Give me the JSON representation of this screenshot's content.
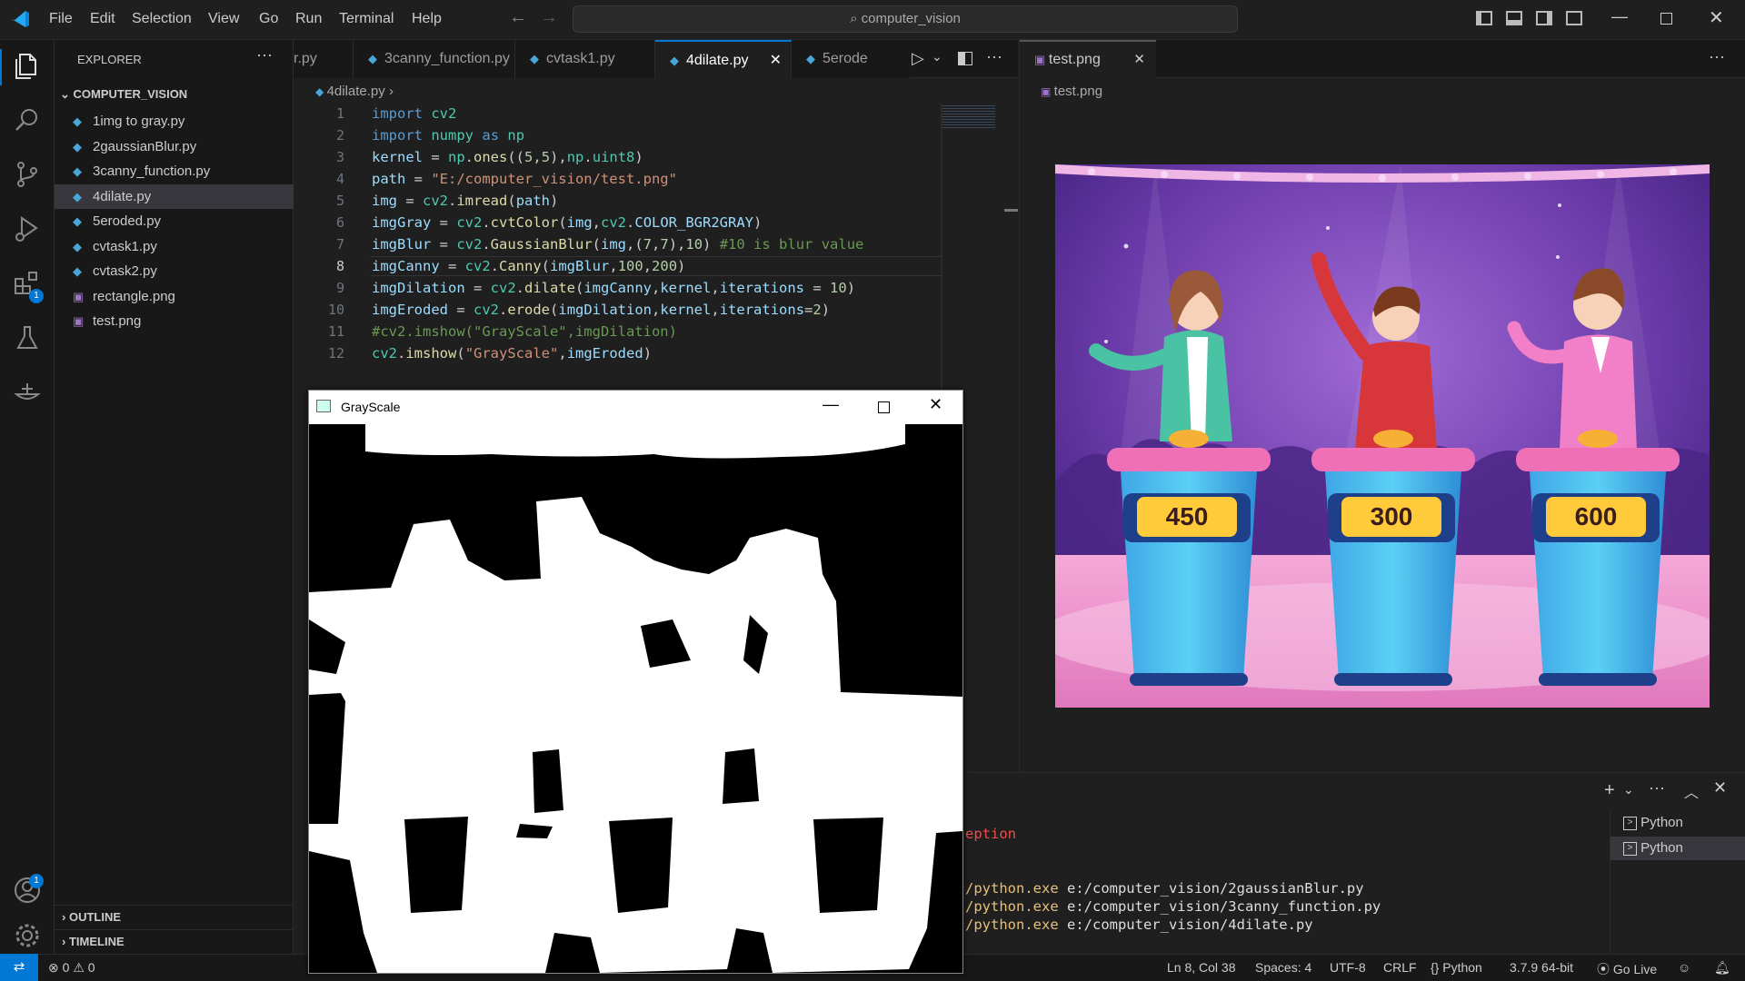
{
  "menu": [
    "File",
    "Edit",
    "Selection",
    "View",
    "Go",
    "Run",
    "Terminal",
    "Help"
  ],
  "search_text": "computer_vision",
  "activity_badges": {
    "extensions": "1",
    "accounts": "1"
  },
  "explorer": {
    "title": "EXPLORER",
    "folder": "COMPUTER_VISION",
    "files": [
      {
        "name": "1img to gray.py",
        "type": "py"
      },
      {
        "name": "2gaussianBlur.py",
        "type": "py"
      },
      {
        "name": "3canny_function.py",
        "type": "py"
      },
      {
        "name": "4dilate.py",
        "type": "py",
        "selected": true
      },
      {
        "name": "5eroded.py",
        "type": "py"
      },
      {
        "name": "cvtask1.py",
        "type": "py"
      },
      {
        "name": "cvtask2.py",
        "type": "py"
      },
      {
        "name": "rectangle.png",
        "type": "png"
      },
      {
        "name": "test.png",
        "type": "png"
      }
    ],
    "outline": "OUTLINE",
    "timeline": "TIMELINE"
  },
  "tabs": [
    {
      "label": "r.py"
    },
    {
      "label": "3canny_function.py"
    },
    {
      "label": "cvtask1.py"
    },
    {
      "label": "4dilate.py",
      "active": true
    },
    {
      "label": "5erode"
    }
  ],
  "breadcrumb": "4dilate.py",
  "code_lines": [
    "1",
    "2",
    "3",
    "4",
    "5",
    "6",
    "7",
    "8",
    "9",
    "10",
    "11",
    "12"
  ],
  "right_tab": "test.png",
  "right_breadcrumb": "test.png",
  "game_show_scores": [
    "450",
    "300",
    "600"
  ],
  "cv_window_title": "GrayScale",
  "terminal": {
    "error_fragment": "eption",
    "lines": [
      {
        "cmd": "/python.exe",
        "arg": " e:/computer_vision/2gaussianBlur.py"
      },
      {
        "cmd": "/python.exe",
        "arg": " e:/computer_vision/3canny_function.py"
      },
      {
        "cmd": "/python.exe",
        "arg": " e:/computer_vision/4dilate.py"
      }
    ],
    "sessions": [
      "Python",
      "Python"
    ]
  },
  "status": {
    "errors": "0",
    "warnings": "0",
    "position": "Ln 8, Col 38",
    "spaces": "Spaces: 4",
    "encoding": "UTF-8",
    "eol": "CRLF",
    "language": "Python",
    "interpreter": "3.7.9 64-bit",
    "golive": "Go Live"
  }
}
